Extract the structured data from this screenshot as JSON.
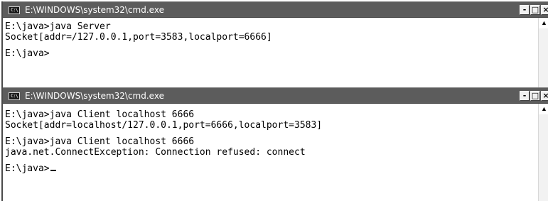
{
  "windows": [
    {
      "title": "E:\\WINDOWS\\system32\\cmd.exe",
      "controls": {
        "minimize": "-",
        "maximize": "□",
        "close": "×"
      },
      "lines": [
        "E:\\java>java Server",
        "Socket[addr=/127.0.0.1,port=3583,localport=6666]",
        "",
        "E:\\java>"
      ]
    },
    {
      "title": "E:\\WINDOWS\\system32\\cmd.exe",
      "controls": {
        "minimize": "-",
        "maximize": "□",
        "close": "×"
      },
      "lines": [
        "E:\\java>java Client localhost 6666",
        "Socket[addr=localhost/127.0.0.1,port=6666,localport=3583]",
        "",
        "E:\\java>java Client localhost 6666",
        "java.net.ConnectException: Connection refused: connect",
        "",
        "E:\\java>"
      ]
    }
  ],
  "icons": {
    "app_icon": "cmd-icon",
    "app_icon_glyph": "C:\\",
    "scroll_up": "▲"
  }
}
